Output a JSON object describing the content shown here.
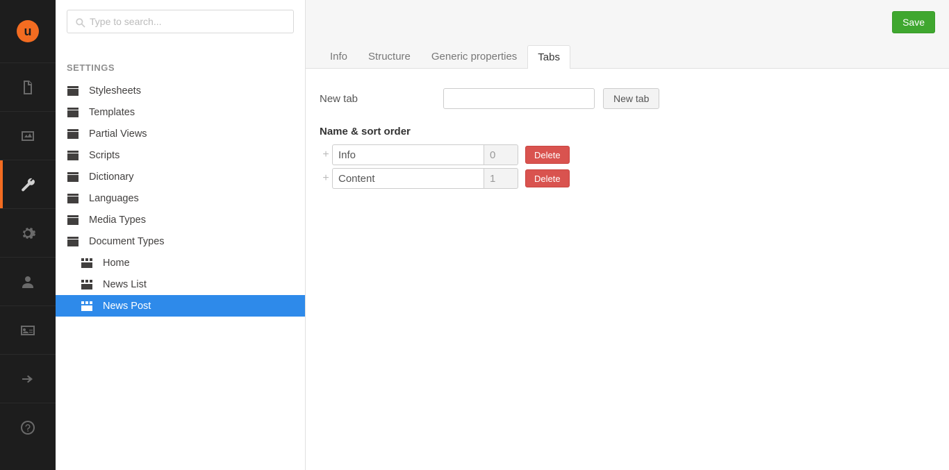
{
  "rail": {
    "logo_letter": "u",
    "items": [
      {
        "name": "content",
        "active": false
      },
      {
        "name": "media",
        "active": false
      },
      {
        "name": "settings",
        "active": true
      },
      {
        "name": "developer",
        "active": false
      },
      {
        "name": "users",
        "active": false
      },
      {
        "name": "members",
        "active": false
      },
      {
        "name": "forms",
        "active": false
      },
      {
        "name": "help",
        "active": false
      }
    ]
  },
  "tree": {
    "search_placeholder": "Type to search...",
    "section_label": "SETTINGS",
    "nodes": [
      {
        "label": "Stylesheets",
        "type": "folder"
      },
      {
        "label": "Templates",
        "type": "folder"
      },
      {
        "label": "Partial Views",
        "type": "folder"
      },
      {
        "label": "Scripts",
        "type": "folder"
      },
      {
        "label": "Dictionary",
        "type": "folder"
      },
      {
        "label": "Languages",
        "type": "folder"
      },
      {
        "label": "Media Types",
        "type": "folder"
      },
      {
        "label": "Document Types",
        "type": "folder"
      }
    ],
    "children": [
      {
        "label": "Home",
        "selected": false
      },
      {
        "label": "News List",
        "selected": false
      },
      {
        "label": "News Post",
        "selected": true
      }
    ]
  },
  "header": {
    "save_label": "Save",
    "tabs": [
      {
        "label": "Info",
        "active": false
      },
      {
        "label": "Structure",
        "active": false
      },
      {
        "label": "Generic properties",
        "active": false
      },
      {
        "label": "Tabs",
        "active": true
      }
    ]
  },
  "form": {
    "new_tab_label": "New tab",
    "new_tab_button": "New tab",
    "section_label": "Name & sort order",
    "rows": [
      {
        "name": "Info",
        "order": "0",
        "delete_label": "Delete"
      },
      {
        "name": "Content",
        "order": "1",
        "delete_label": "Delete"
      }
    ]
  }
}
